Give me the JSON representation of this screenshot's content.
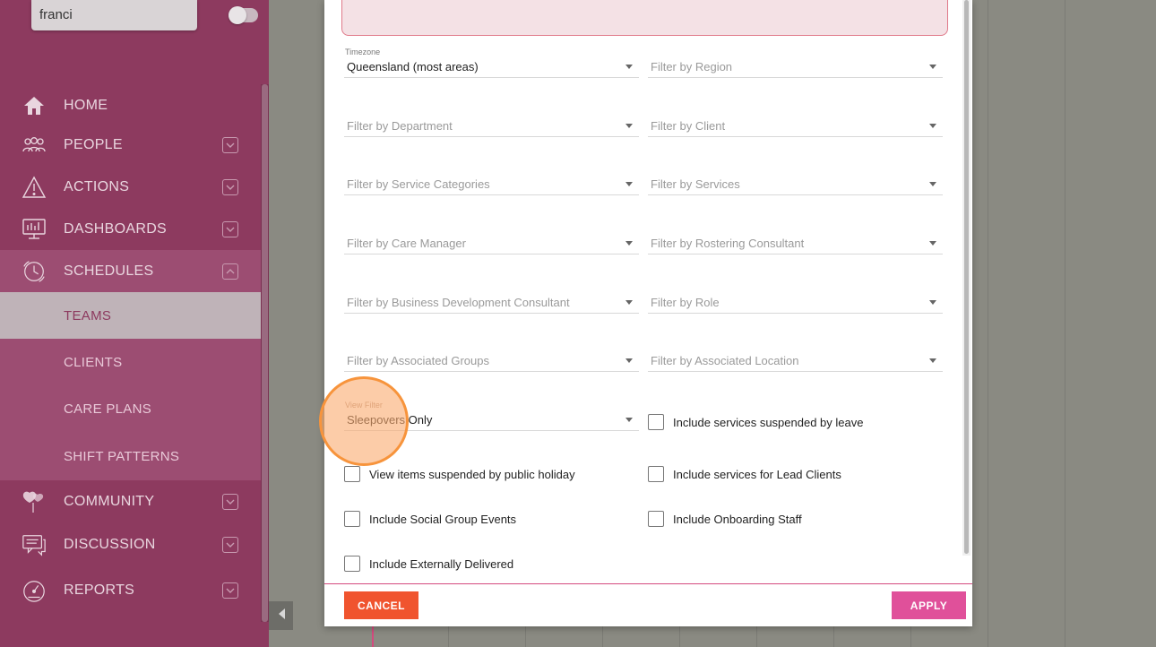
{
  "sidebar": {
    "search_value": "franci",
    "nav": [
      {
        "label": "HOME",
        "icon": "home-icon"
      },
      {
        "label": "PEOPLE",
        "icon": "people-icon"
      },
      {
        "label": "ACTIONS",
        "icon": "warning-icon"
      },
      {
        "label": "DASHBOARDS",
        "icon": "dashboard-icon"
      },
      {
        "label": "SCHEDULES",
        "icon": "clock-icon"
      },
      {
        "label": "COMMUNITY",
        "icon": "hearts-icon"
      },
      {
        "label": "DISCUSSION",
        "icon": "chat-icon"
      },
      {
        "label": "REPORTS",
        "icon": "gauge-icon"
      }
    ],
    "sub": [
      {
        "label": "TEAMS"
      },
      {
        "label": "CLIENTS"
      },
      {
        "label": "CARE PLANS"
      },
      {
        "label": "SHIFT PATTERNS"
      }
    ]
  },
  "modal": {
    "timezone_label": "Timezone",
    "timezone_value": "Queensland (most areas)",
    "filters": {
      "region": "Filter by Region",
      "department": "Filter by Department",
      "client": "Filter by Client",
      "service_categories": "Filter by Service Categories",
      "services": "Filter by Services",
      "care_manager": "Filter by Care Manager",
      "rostering_consultant": "Filter by Rostering Consultant",
      "bdc": "Filter by Business Development Consultant",
      "role": "Filter by Role",
      "associated_groups": "Filter by Associated Groups",
      "associated_location": "Filter by Associated Location"
    },
    "view_filter_label": "View Filter",
    "view_filter_value": "Sleepovers Only",
    "checkboxes": {
      "suspended_by_leave": "Include services suspended by leave",
      "public_holiday": "View items suspended by public holiday",
      "lead_clients": "Include services for Lead Clients",
      "social_group": "Include Social Group Events",
      "onboarding_staff": "Include Onboarding Staff",
      "externally_delivered": "Include Externally Delivered"
    },
    "cancel_label": "CANCEL",
    "apply_label": "APPLY"
  },
  "colors": {
    "sidebar_bg": "#8d3a5f",
    "cancel": "#f0542e",
    "apply": "#e0509a"
  }
}
